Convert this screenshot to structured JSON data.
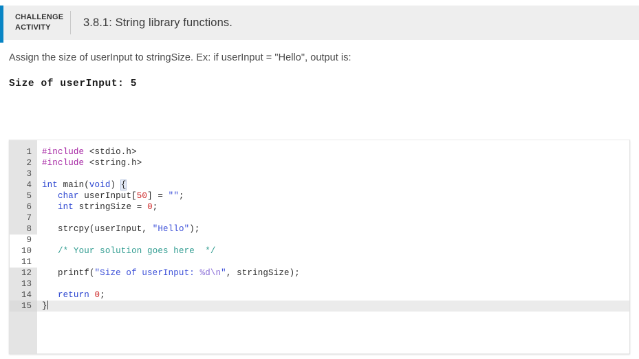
{
  "header": {
    "kicker": "CHALLENGE ACTIVITY",
    "title": "3.8.1: String library functions.",
    "accent_color": "#0884c4",
    "background_color": "#eeeeee"
  },
  "prompt": {
    "instruction": "Assign the size of userInput to stringSize. Ex: if userInput = \"Hello\", output is:",
    "sample_output": "Size of userInput: 5"
  },
  "editor": {
    "active_line": 15,
    "editable_lines": [
      9,
      10,
      11
    ],
    "cursor_line": 15,
    "colors": {
      "preprocessor": "#a626a4",
      "keyword": "#2a44d0",
      "string": "#3b4fd8",
      "escape": "#8b6fd8",
      "number": "#cc2222",
      "comment": "#2e9b8f",
      "gutter_bg": "#e4e4e4",
      "active_line_bg": "#ebebeb"
    },
    "lines": [
      {
        "n": "1",
        "tokens": [
          {
            "t": "#include",
            "c": "pre"
          },
          {
            "t": " ",
            "c": "plain"
          },
          {
            "t": "<stdio.h>",
            "c": "plain"
          }
        ]
      },
      {
        "n": "2",
        "tokens": [
          {
            "t": "#include",
            "c": "pre"
          },
          {
            "t": " ",
            "c": "plain"
          },
          {
            "t": "<string.h>",
            "c": "plain"
          }
        ]
      },
      {
        "n": "3",
        "tokens": []
      },
      {
        "n": "4",
        "tokens": [
          {
            "t": "int",
            "c": "kw"
          },
          {
            "t": " main(",
            "c": "plain"
          },
          {
            "t": "void",
            "c": "kw"
          },
          {
            "t": ") ",
            "c": "plain"
          },
          {
            "t": "{",
            "c": "bracket"
          }
        ]
      },
      {
        "n": "5",
        "tokens": [
          {
            "t": "   ",
            "c": "plain"
          },
          {
            "t": "char",
            "c": "kw"
          },
          {
            "t": " userInput[",
            "c": "plain"
          },
          {
            "t": "50",
            "c": "num"
          },
          {
            "t": "] = ",
            "c": "plain"
          },
          {
            "t": "\"\"",
            "c": "str"
          },
          {
            "t": ";",
            "c": "plain"
          }
        ]
      },
      {
        "n": "6",
        "tokens": [
          {
            "t": "   ",
            "c": "plain"
          },
          {
            "t": "int",
            "c": "kw"
          },
          {
            "t": " stringSize = ",
            "c": "plain"
          },
          {
            "t": "0",
            "c": "num"
          },
          {
            "t": ";",
            "c": "plain"
          }
        ]
      },
      {
        "n": "7",
        "tokens": []
      },
      {
        "n": "8",
        "tokens": [
          {
            "t": "   strcpy(userInput, ",
            "c": "plain"
          },
          {
            "t": "\"Hello\"",
            "c": "str"
          },
          {
            "t": ");",
            "c": "plain"
          }
        ]
      },
      {
        "n": "9",
        "tokens": []
      },
      {
        "n": "10",
        "tokens": [
          {
            "t": "   ",
            "c": "plain"
          },
          {
            "t": "/* Your solution goes here  */",
            "c": "cmt"
          }
        ]
      },
      {
        "n": "11",
        "tokens": []
      },
      {
        "n": "12",
        "tokens": [
          {
            "t": "   printf(",
            "c": "plain"
          },
          {
            "t": "\"Size of userInput: ",
            "c": "str"
          },
          {
            "t": "%d\\n",
            "c": "esc"
          },
          {
            "t": "\"",
            "c": "str"
          },
          {
            "t": ", stringSize);",
            "c": "plain"
          }
        ]
      },
      {
        "n": "13",
        "tokens": []
      },
      {
        "n": "14",
        "tokens": [
          {
            "t": "   ",
            "c": "plain"
          },
          {
            "t": "return",
            "c": "kw"
          },
          {
            "t": " ",
            "c": "plain"
          },
          {
            "t": "0",
            "c": "num"
          },
          {
            "t": ";",
            "c": "plain"
          }
        ]
      },
      {
        "n": "15",
        "tokens": [
          {
            "t": "}",
            "c": "plain"
          }
        ]
      }
    ]
  }
}
